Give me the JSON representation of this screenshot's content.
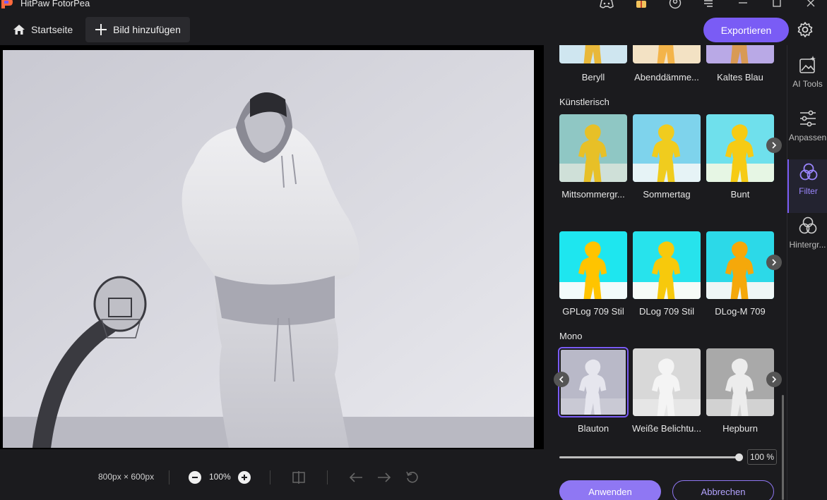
{
  "app": {
    "title": "HitPaw FotorPea"
  },
  "toolbar": {
    "home_label": "Startseite",
    "add_image_label": "Bild hinzufügen",
    "export_label": "Exportieren"
  },
  "status": {
    "dimensions": "800px × 600px",
    "zoom": "100%"
  },
  "panel": {
    "top_row": [
      {
        "label": "Beryll"
      },
      {
        "label": "Abenddämme..."
      },
      {
        "label": "Kaltes Blau"
      }
    ],
    "sections": [
      {
        "title": "Künstlerisch",
        "rows": [
          [
            {
              "label": "Mittsommergr..."
            },
            {
              "label": "Sommertag"
            },
            {
              "label": "Bunt"
            }
          ],
          [
            {
              "label": "GPLog 709 Stil"
            },
            {
              "label": "DLog 709 Stil"
            },
            {
              "label": "DLog-M 709"
            }
          ]
        ]
      },
      {
        "title": "Mono",
        "rows": [
          [
            {
              "label": "Blauton"
            },
            {
              "label": "Weiße Belichtu..."
            },
            {
              "label": "Hepburn"
            }
          ]
        ]
      }
    ],
    "intensity": {
      "value": 1.0,
      "display": "100 %"
    },
    "apply_label": "Anwenden",
    "cancel_label": "Abbrechen"
  },
  "sidebar": {
    "items": [
      {
        "label": "AI Tools",
        "icon": "ai-tools-icon"
      },
      {
        "label": "Anpassen",
        "icon": "sliders-icon"
      },
      {
        "label": "Filter",
        "icon": "filter-icon",
        "active": true
      },
      {
        "label": "Hintergr...",
        "icon": "background-icon"
      }
    ]
  },
  "colors": {
    "accent": "#7a5cf5",
    "background": "#1b1b1e"
  }
}
